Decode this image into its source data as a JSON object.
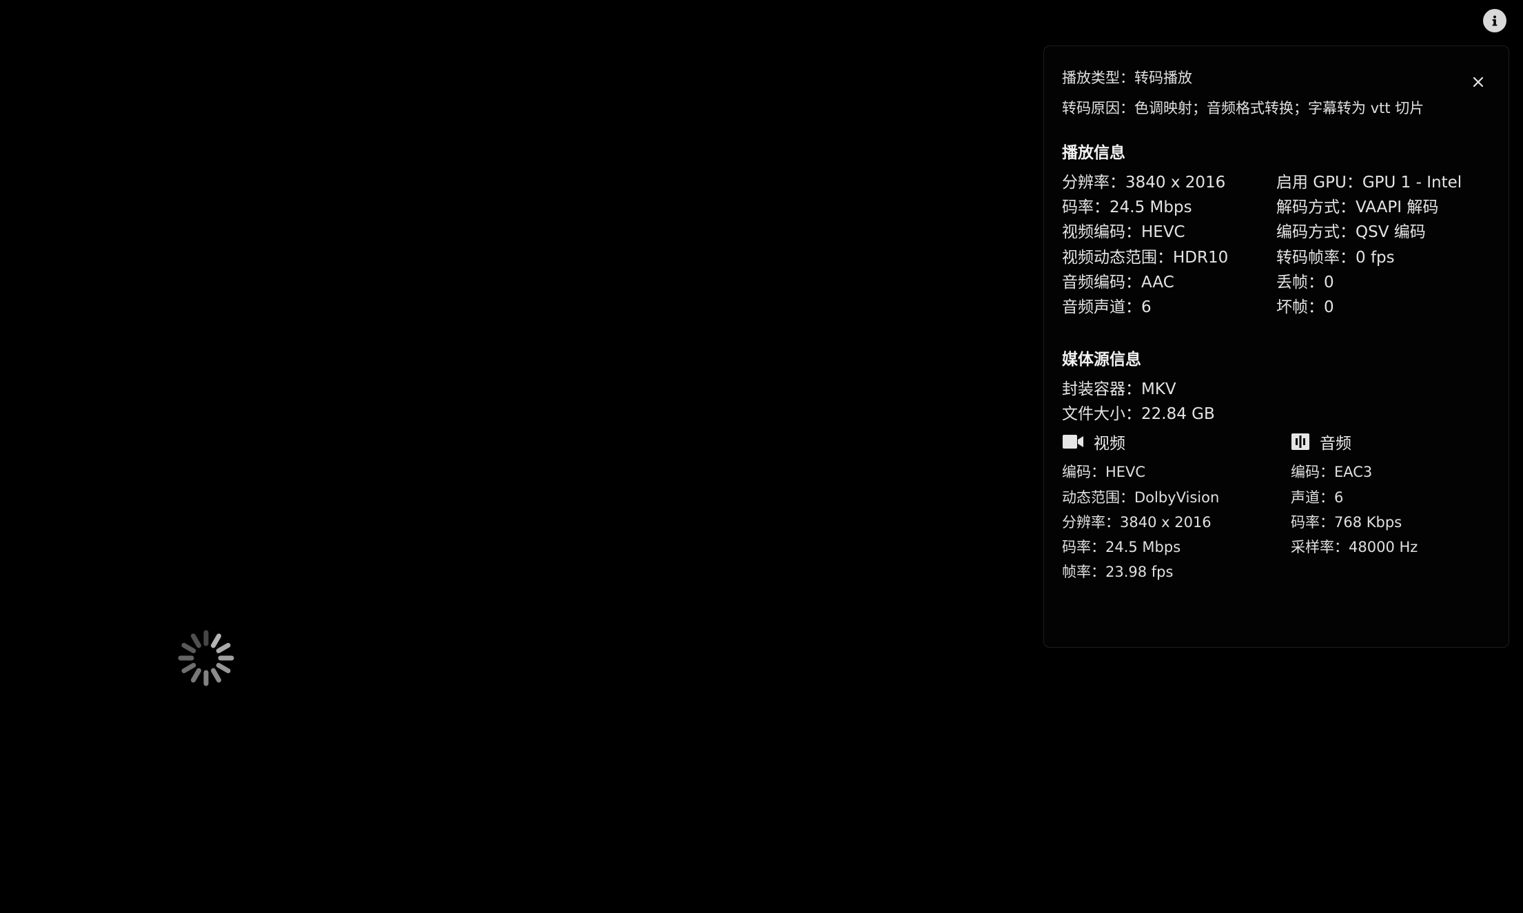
{
  "panel": {
    "play_type": "播放类型：转码播放",
    "transcode_reason": "转码原因：色调映射；音频格式转换；字幕转为 vtt 切片",
    "playback_heading": "播放信息",
    "playback_left": [
      "分辨率：3840 x 2016",
      "码率：24.5 Mbps",
      "视频编码：HEVC",
      "视频动态范围：HDR10",
      "音频编码：AAC",
      "音频声道：6"
    ],
    "playback_right": [
      "启用 GPU：GPU 1 - Intel",
      "解码方式：VAAPI 解码",
      "编码方式：QSV 编码",
      "转码帧率：0 fps",
      "丢帧：0",
      "坏帧：0"
    ],
    "source_heading": "媒体源信息",
    "container": "封装容器：MKV",
    "file_size": "文件大小：22.84 GB",
    "video": {
      "title": "视频",
      "icon": "video-camera-icon",
      "lines": [
        "编码：HEVC",
        "动态范围：DolbyVision",
        "分辨率：3840 x 2016",
        "码率：24.5 Mbps",
        "帧率：23.98 fps"
      ]
    },
    "audio": {
      "title": "音频",
      "icon": "audio-waveform-icon",
      "lines": [
        "编码：EAC3",
        "声道：6",
        "码率：768 Kbps",
        "采样率：48000 Hz"
      ]
    }
  },
  "icons": {
    "info": "info-icon",
    "close": "close-icon",
    "loading": "loading-spinner-icon"
  },
  "colors": {
    "background": "#000000",
    "panel_background": "#030303",
    "panel_border": "#1e1e1e",
    "text": "#e4e4e4",
    "heading": "#f2f2f2"
  }
}
